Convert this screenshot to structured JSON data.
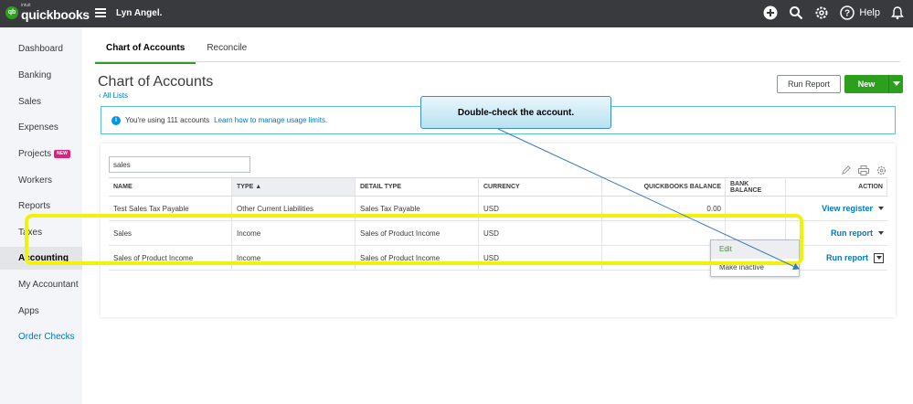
{
  "topbar": {
    "logo_small": "intuit",
    "logo_word": "quickbooks",
    "logo_mark": "qb",
    "company_name": "Lyn Angel.",
    "help_label": "Help",
    "icons": [
      "plus-icon",
      "search-icon",
      "gear-icon",
      "help-icon",
      "bell-icon"
    ]
  },
  "sidebar": {
    "items": [
      {
        "label": "Dashboard"
      },
      {
        "label": "Banking"
      },
      {
        "label": "Sales"
      },
      {
        "label": "Expenses"
      },
      {
        "label": "Projects",
        "badge": "NEW"
      },
      {
        "label": "Workers"
      },
      {
        "label": "Reports"
      },
      {
        "label": "Taxes"
      },
      {
        "label": "Accounting",
        "active": true
      },
      {
        "label": "My Accountant"
      },
      {
        "label": "Apps"
      },
      {
        "label": "Order Checks",
        "link": true
      }
    ]
  },
  "tabs": [
    {
      "label": "Chart of Accounts",
      "active": true
    },
    {
      "label": "Reconcile"
    }
  ],
  "page": {
    "title": "Chart of Accounts",
    "back_link": "All Lists",
    "run_report_label": "Run Report",
    "new_label": "New"
  },
  "info": {
    "text": "You're using 111 accounts",
    "link": "Learn how to manage usage limits."
  },
  "search": {
    "value": "sales"
  },
  "table": {
    "headers": {
      "name": "NAME",
      "type": "TYPE ▲",
      "detail": "DETAIL TYPE",
      "currency": "CURRENCY",
      "qb_balance": "QUICKBOOKS BALANCE",
      "bank_balance": "BANK BALANCE",
      "action": "ACTION"
    },
    "rows": [
      {
        "name": "Test Sales Tax Payable",
        "type": "Other Current Liabilities",
        "detail": "Sales Tax Payable",
        "currency": "USD",
        "qb_balance": "0.00",
        "bank_balance": "",
        "action": "View register"
      },
      {
        "name": "Sales",
        "type": "Income",
        "detail": "Sales of Product Income",
        "currency": "USD",
        "qb_balance": "",
        "bank_balance": "",
        "action": "Run report"
      },
      {
        "name": "Sales of Product Income",
        "type": "Income",
        "detail": "Sales of Product Income",
        "currency": "USD",
        "qb_balance": "",
        "bank_balance": "",
        "action": "Run report"
      }
    ]
  },
  "dropdown": {
    "items": [
      "Edit",
      "Make inactive"
    ]
  },
  "callout": {
    "text": "Double-check the account."
  },
  "colors": {
    "brand_green": "#2ca01c",
    "link_blue": "#0077c5",
    "highlight_yellow": "#f0f20c",
    "topbar": "#393a3d"
  }
}
